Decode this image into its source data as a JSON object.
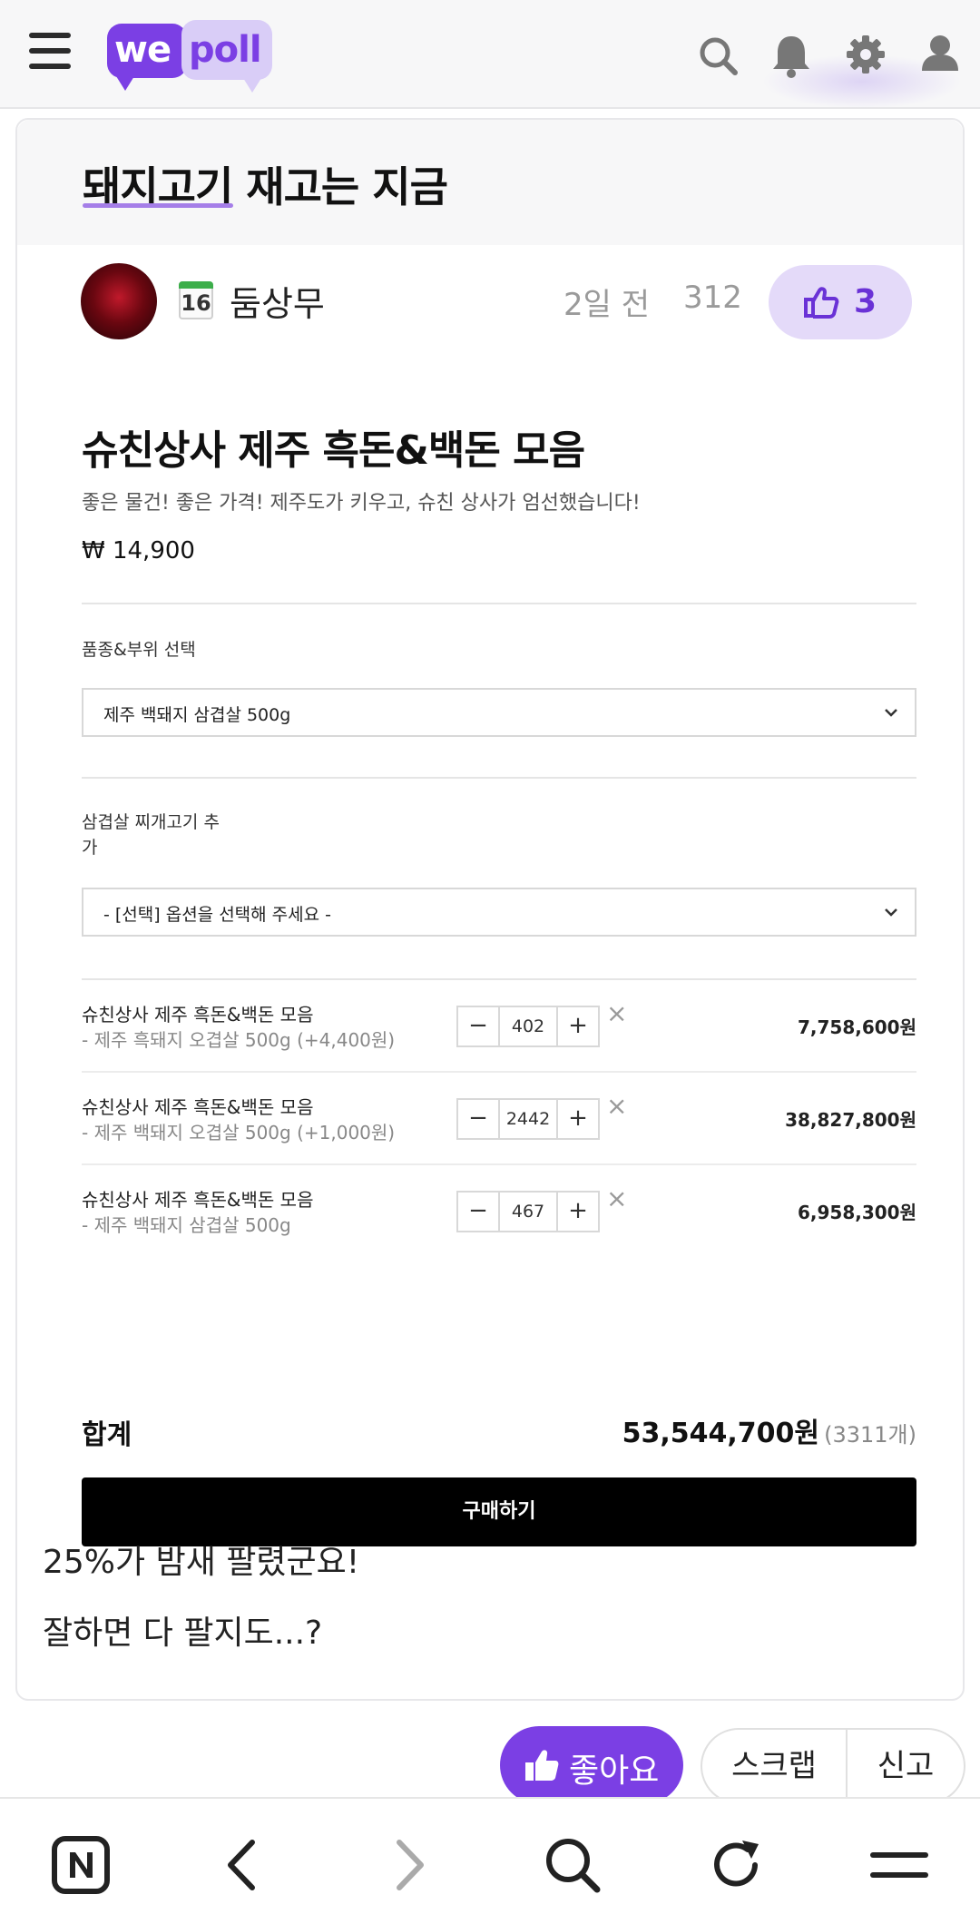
{
  "app": {
    "logo_we": "we",
    "logo_poll": "poll",
    "brand_color": "#7b3fe4"
  },
  "topbar": {
    "icons": [
      "menu-icon",
      "search-icon",
      "bell-icon",
      "gear-icon",
      "user-icon"
    ]
  },
  "post": {
    "title": "돼지고기 재고는 지금",
    "author": {
      "level": "16",
      "name": "둠상무"
    },
    "time": "2일 전",
    "views": "312",
    "likes": "3",
    "body_lines": [
      "25%가 밤새 팔렸군요!",
      "잘하면 다 팔지도...?"
    ]
  },
  "shop": {
    "title": "슈친상사 제주 흑돈&백돈 모음",
    "description": "좋은 물건! 좋은 가격! 제주도가 키우고, 슈친 상사가 엄선했습니다!",
    "price": "₩ 14,900",
    "option1": {
      "label": "품종&부위 선택",
      "selected": "제주 백돼지 삼겹살 500g"
    },
    "option2": {
      "label": "삼겹살 찌개고기 추가",
      "selected": "- [선택] 옵션을 선택해 주세요 -"
    },
    "stepper": {
      "minus": "−",
      "plus": "+",
      "remove": "×"
    },
    "items": [
      {
        "name": "슈친상사 제주 흑돈&백돈 모음",
        "option": "- 제주 흑돼지 오겹살 500g (+4,400원)",
        "qty": "402",
        "amount": "7,758,600원"
      },
      {
        "name": "슈친상사 제주 흑돈&백돈 모음",
        "option": "- 제주 백돼지 오겹살 500g (+1,000원)",
        "qty": "2442",
        "amount": "38,827,800원"
      },
      {
        "name": "슈친상사 제주 흑돈&백돈 모음",
        "option": "- 제주 백돼지 삼겹살 500g",
        "qty": "467",
        "amount": "6,958,300원"
      }
    ],
    "total_label": "합계",
    "total_amount": "53,544,700원",
    "total_count": "(3311개)",
    "buy_label": "구매하기"
  },
  "actions": {
    "like_label": "좋아요",
    "scrap_label": "스크랩",
    "report_label": "신고"
  },
  "browser": {
    "icons": [
      "naver-home-icon",
      "back-icon",
      "forward-icon",
      "search-icon",
      "reload-icon",
      "menu-icon"
    ]
  }
}
